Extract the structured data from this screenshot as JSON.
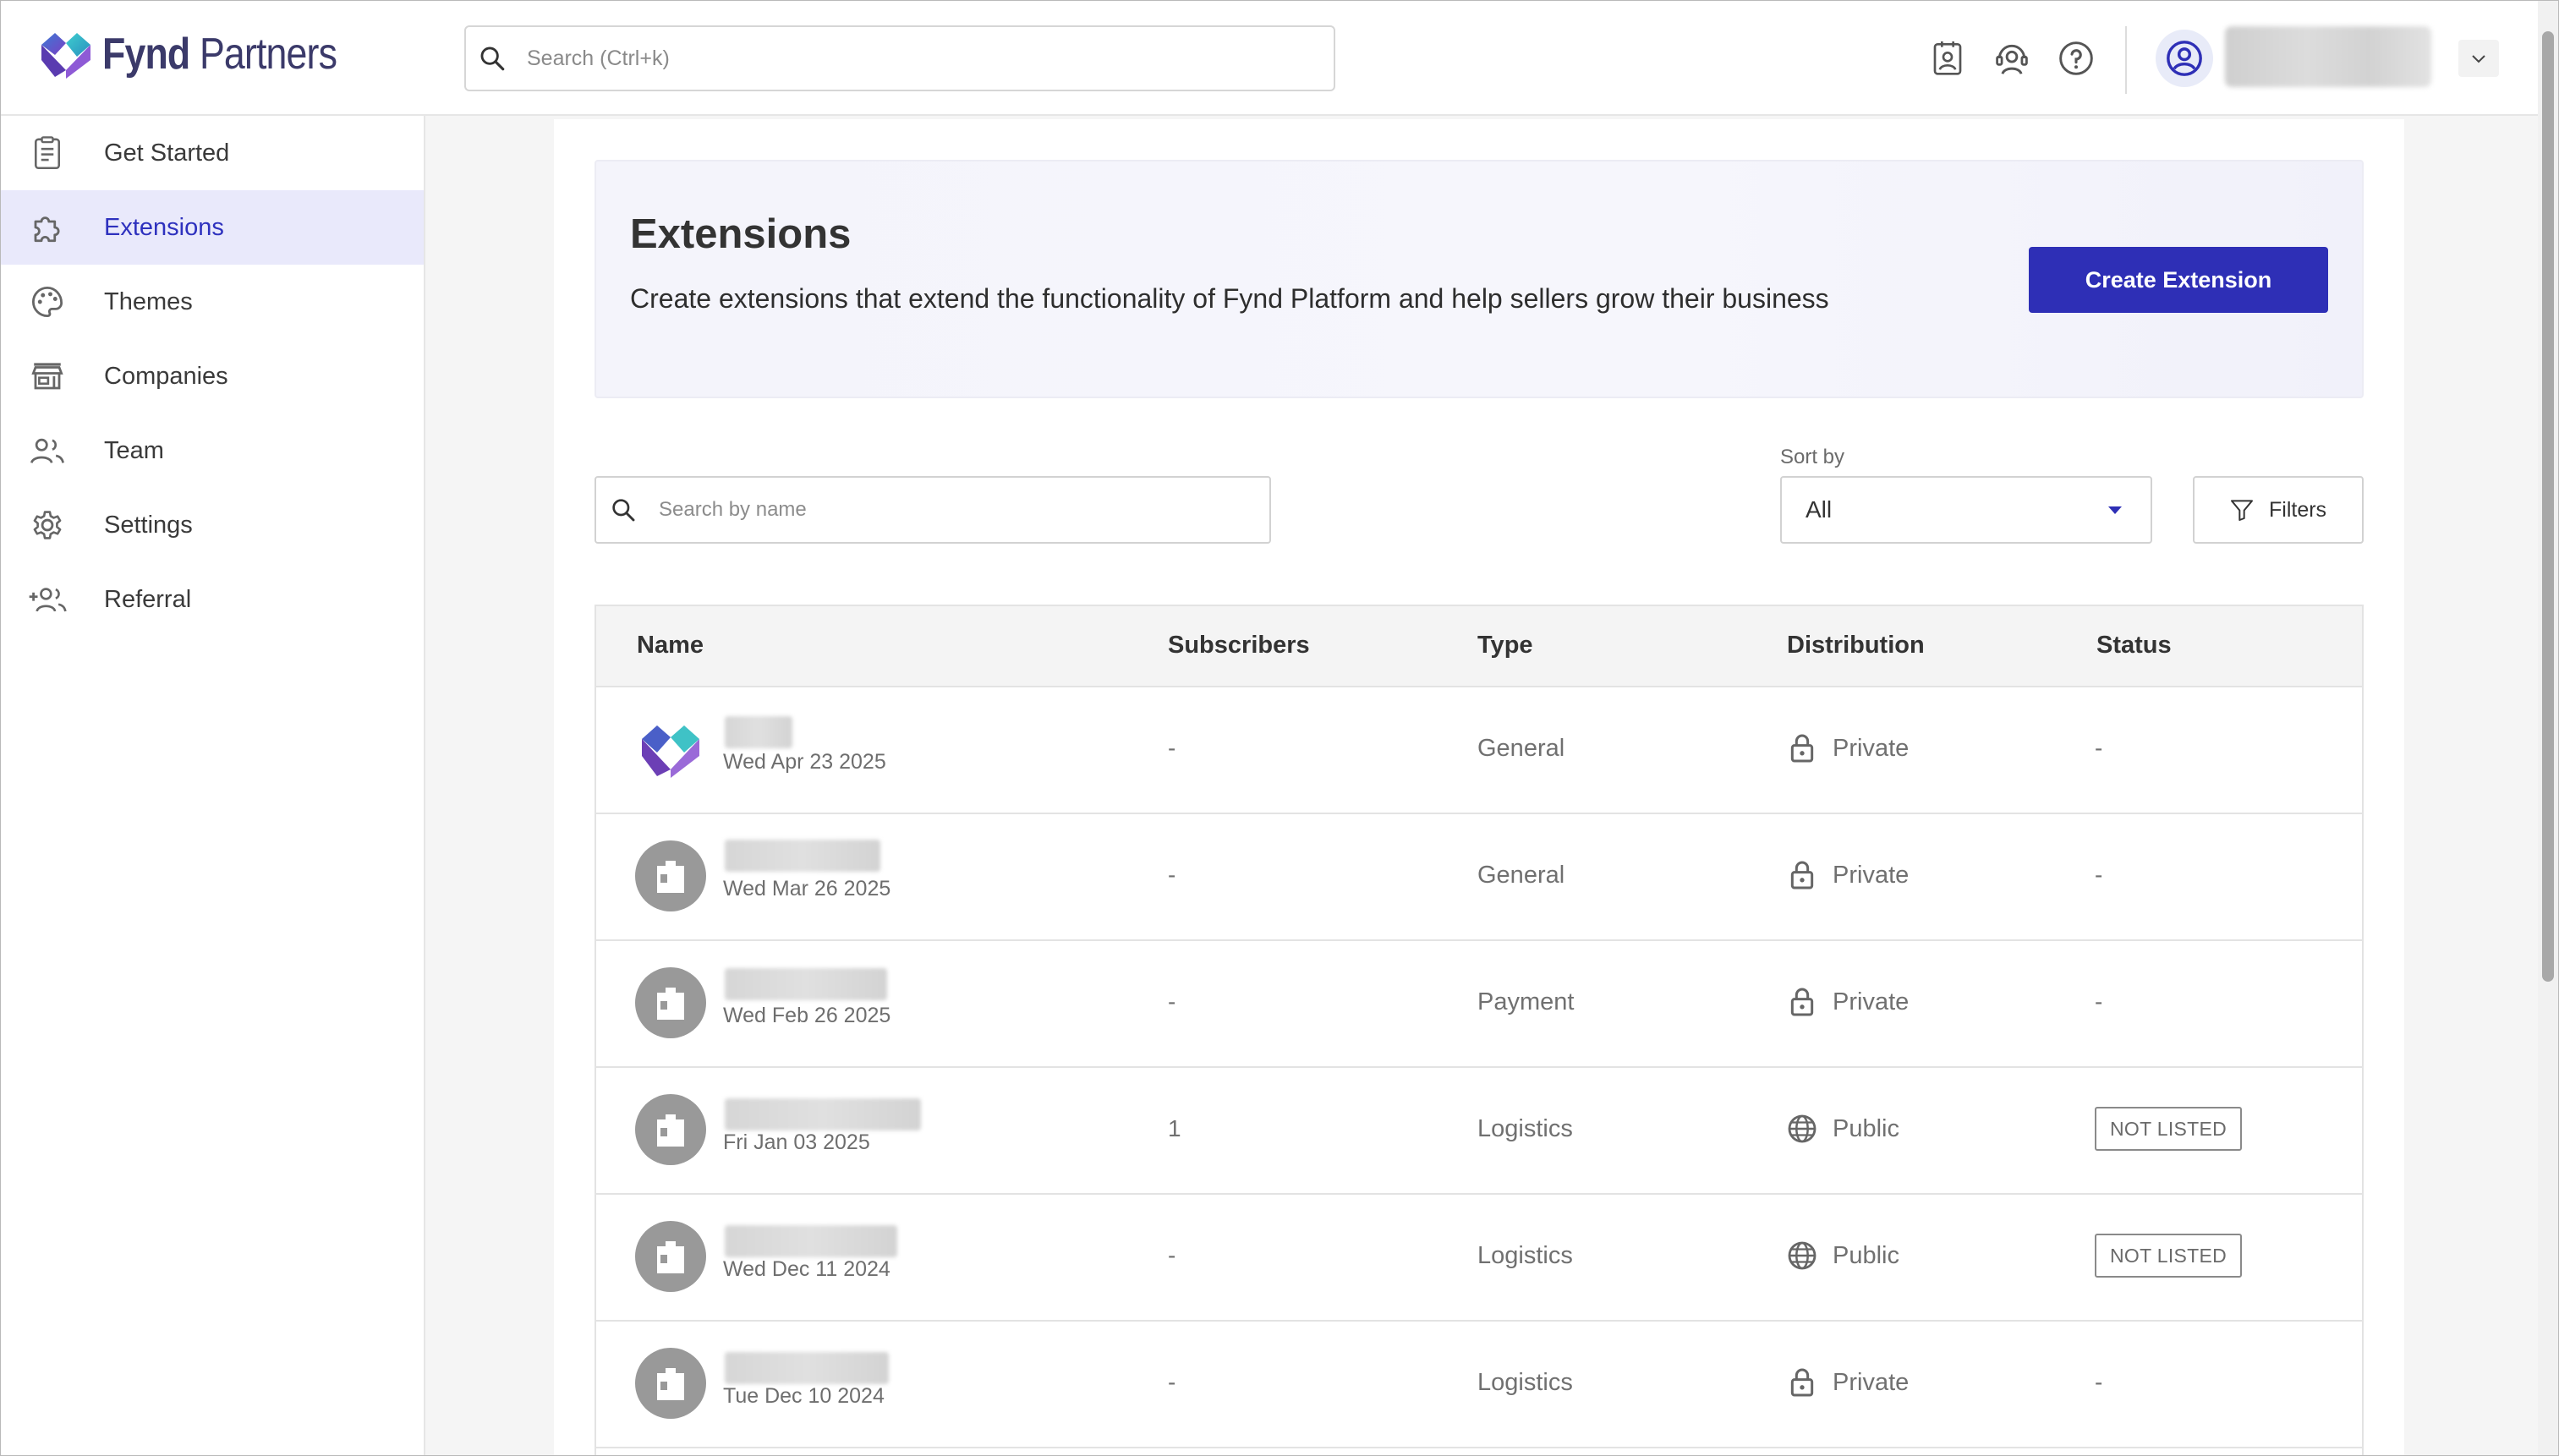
{
  "app": {
    "brand_bold": "Fynd",
    "brand_rest": " Partners"
  },
  "header": {
    "search_placeholder": "Search (Ctrl+k)",
    "icons": [
      "contact-book-icon",
      "support-agent-icon",
      "help-icon"
    ],
    "user_avatar_icon": "user-circle-icon",
    "user_menu_icon": "chevron-down-icon"
  },
  "sidebar": {
    "items": [
      {
        "label": "Get Started",
        "icon": "clipboard-icon"
      },
      {
        "label": "Extensions",
        "icon": "puzzle-icon",
        "active": true
      },
      {
        "label": "Themes",
        "icon": "palette-icon"
      },
      {
        "label": "Companies",
        "icon": "store-icon"
      },
      {
        "label": "Team",
        "icon": "people-icon"
      },
      {
        "label": "Settings",
        "icon": "gear-icon"
      },
      {
        "label": "Referral",
        "icon": "add-people-icon"
      }
    ]
  },
  "banner": {
    "title": "Extensions",
    "description": "Create extensions that extend the functionality of Fynd Platform and help sellers grow their business",
    "create_button": "Create Extension"
  },
  "toolbar": {
    "search_placeholder": "Search by name",
    "sort_label": "Sort by",
    "sort_value": "All",
    "filters_label": "Filters"
  },
  "table": {
    "columns": [
      "Name",
      "Subscribers",
      "Type",
      "Distribution",
      "Status"
    ],
    "rows": [
      {
        "date": "Wed Apr 23 2025",
        "subscribers": "-",
        "type": "General",
        "distribution": "Private",
        "status": "-"
      },
      {
        "date": "Wed Mar 26 2025",
        "subscribers": "-",
        "type": "General",
        "distribution": "Private",
        "status": "-"
      },
      {
        "date": "Wed Feb 26 2025",
        "subscribers": "-",
        "type": "Payment",
        "distribution": "Private",
        "status": "-"
      },
      {
        "date": "Fri Jan 03 2025",
        "subscribers": "1",
        "type": "Logistics",
        "distribution": "Public",
        "status": "NOT LISTED"
      },
      {
        "date": "Wed Dec 11 2024",
        "subscribers": "-",
        "type": "Logistics",
        "distribution": "Public",
        "status": "NOT LISTED"
      },
      {
        "date": "Tue Dec 10 2024",
        "subscribers": "-",
        "type": "Logistics",
        "distribution": "Private",
        "status": "-"
      }
    ]
  },
  "colors": {
    "accent": "#2e2fb6",
    "active_nav_bg": "#e9e9fb"
  }
}
